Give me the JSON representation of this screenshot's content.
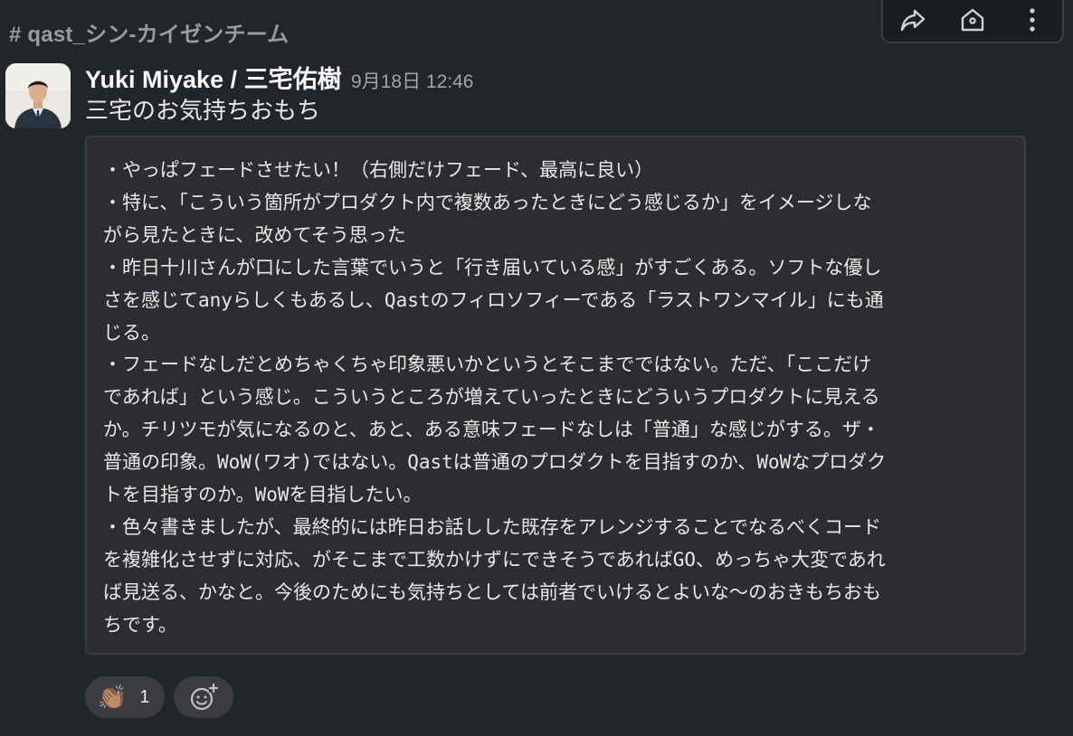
{
  "channel": {
    "label": "# qast_シン-カイゼンチーム"
  },
  "toolbar": {
    "icons": [
      "share-icon",
      "home-icon",
      "more-icon"
    ]
  },
  "message": {
    "author": "Yuki Miyake / 三宅佑樹",
    "timestamp": "9月18日 12:46",
    "text": "三宅のお気持ちおもち",
    "code_lines": [
      "・やっぱフェードさせたい！（右側だけフェード、最高に良い）",
      "・特に、「こういう箇所がプロダクト内で複数あったときにどう感じるか」をイメージしな",
      "がら見たときに、改めてそう思った",
      "・昨日十川さんが口にした言葉でいうと「行き届いている感」がすごくある。ソフトな優し",
      "さを感じてanyらしくもあるし、Qastのフィロソフィーである「ラストワンマイル」にも通",
      "じる。",
      "・フェードなしだとめちゃくちゃ印象悪いかというとそこまでではない。ただ、「ここだけ",
      "であれば」という感じ。こういうところが増えていったときにどういうプロダクトに見える",
      "か。チリツモが気になるのと、あと、ある意味フェードなしは「普通」な感じがする。ザ・",
      "普通の印象。WoW(ワオ)ではない。Qastは普通のプロダクトを目指すのか、WoWなプロダク",
      "トを目指すのか。WoWを目指したい。",
      "・色々書きましたが、最終的には昨日お話しした既存をアレンジすることでなるべくコード",
      "を複雑化させずに対応、がそこまで工数かけずにできそうであればGO、めっちゃ大変であれ",
      "ば見送る、かなと。今後のためにも気持ちとしては前者でいけるとよいな〜のおきもちおも",
      "ちです。"
    ]
  },
  "reactions": [
    {
      "emoji": "👏🏽",
      "icon": "clapping-hands-icon",
      "count": "1"
    }
  ],
  "add_reaction": {
    "icon": "add-reaction-icon"
  },
  "colors": {
    "background": "#222529",
    "code_background": "#2c2d30",
    "border": "#3b3d41",
    "text": "#e8e8e8",
    "muted": "#9a9b9d"
  }
}
